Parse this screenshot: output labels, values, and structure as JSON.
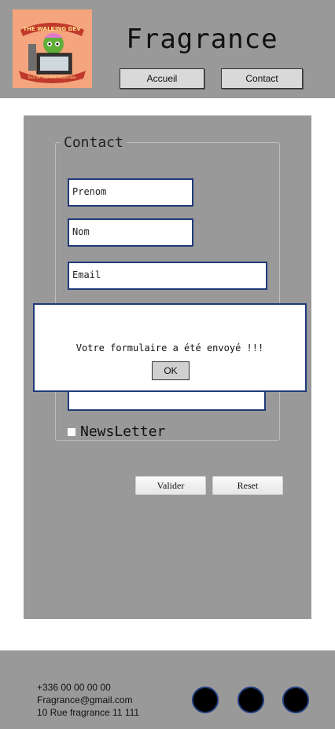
{
  "header": {
    "logo": {
      "line1": "THE WALKING DEV",
      "line2": "Tout de nouveau disponible"
    },
    "title": "Fragrance",
    "nav": [
      {
        "label": "Accueil"
      },
      {
        "label": "Contact"
      }
    ]
  },
  "form": {
    "legend": "Contact",
    "fields": {
      "prenom": "Prenom",
      "nom": "Nom",
      "email": "Email",
      "message": ""
    },
    "newsletter_label": "NewsLetter",
    "submit_label": "Valider",
    "reset_label": "Reset"
  },
  "modal": {
    "message": "Votre formulaire a été envoyé !!!",
    "ok_label": "OK"
  },
  "footer": {
    "phone": "+336 00 00 00 00",
    "email": "Fragrance@gmail.com",
    "address": "10 Rue fragrance 11 111"
  },
  "colors": {
    "panel_gray": "#999999",
    "field_border": "#1f3a7a",
    "logo_bg": "#f4a57d"
  }
}
